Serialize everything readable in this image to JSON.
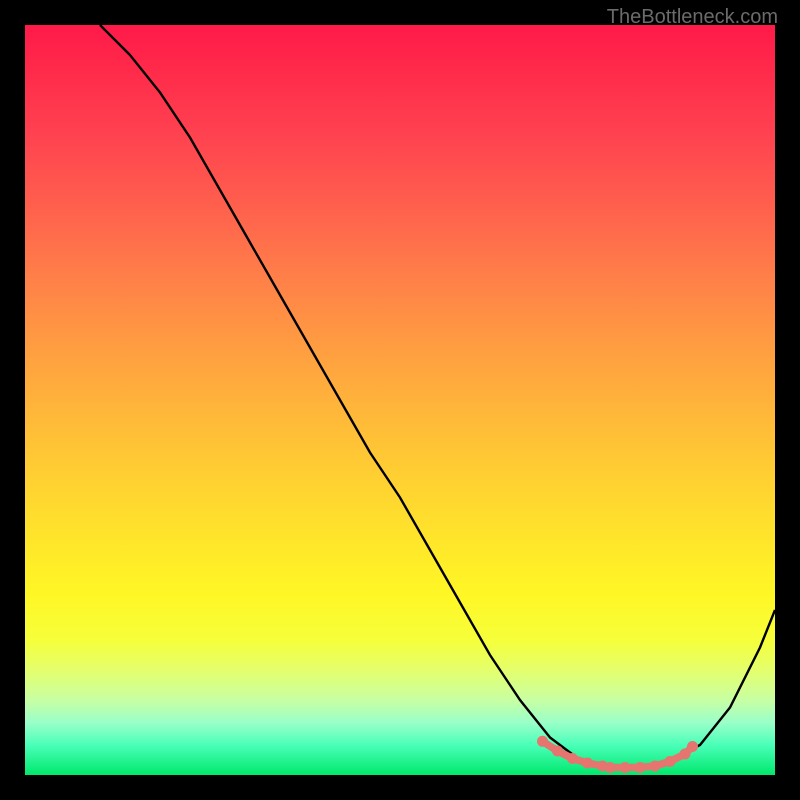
{
  "watermark": "TheBottleneck.com",
  "chart_data": {
    "type": "line",
    "title": "",
    "xlabel": "",
    "ylabel": "",
    "xlim": [
      0,
      100
    ],
    "ylim": [
      0,
      100
    ],
    "grid": false,
    "series": [
      {
        "name": "curve",
        "color": "#000000",
        "x": [
          10,
          14,
          18,
          22,
          26,
          30,
          34,
          38,
          42,
          46,
          50,
          54,
          58,
          62,
          66,
          70,
          74,
          78,
          82,
          86,
          90,
          94,
          98,
          100
        ],
        "y": [
          100,
          96,
          91,
          85,
          78,
          71,
          64,
          57,
          50,
          43,
          37,
          30,
          23,
          16,
          10,
          5,
          2,
          1,
          1,
          2,
          4,
          9,
          17,
          22
        ]
      }
    ],
    "highlight_points": {
      "color": "#e6756f",
      "x": [
        69,
        71,
        73,
        75,
        77,
        78,
        80,
        82,
        84,
        86,
        88,
        89
      ],
      "y": [
        4.5,
        3.2,
        2.2,
        1.6,
        1.2,
        1.0,
        1.0,
        1.0,
        1.2,
        1.8,
        2.8,
        3.8
      ]
    },
    "background_gradient": {
      "direction": "vertical",
      "stops": [
        {
          "pos": 0.0,
          "color": "#ff1a4a"
        },
        {
          "pos": 0.5,
          "color": "#ffb53a"
        },
        {
          "pos": 0.78,
          "color": "#fff725"
        },
        {
          "pos": 1.0,
          "color": "#00e86c"
        }
      ]
    }
  }
}
